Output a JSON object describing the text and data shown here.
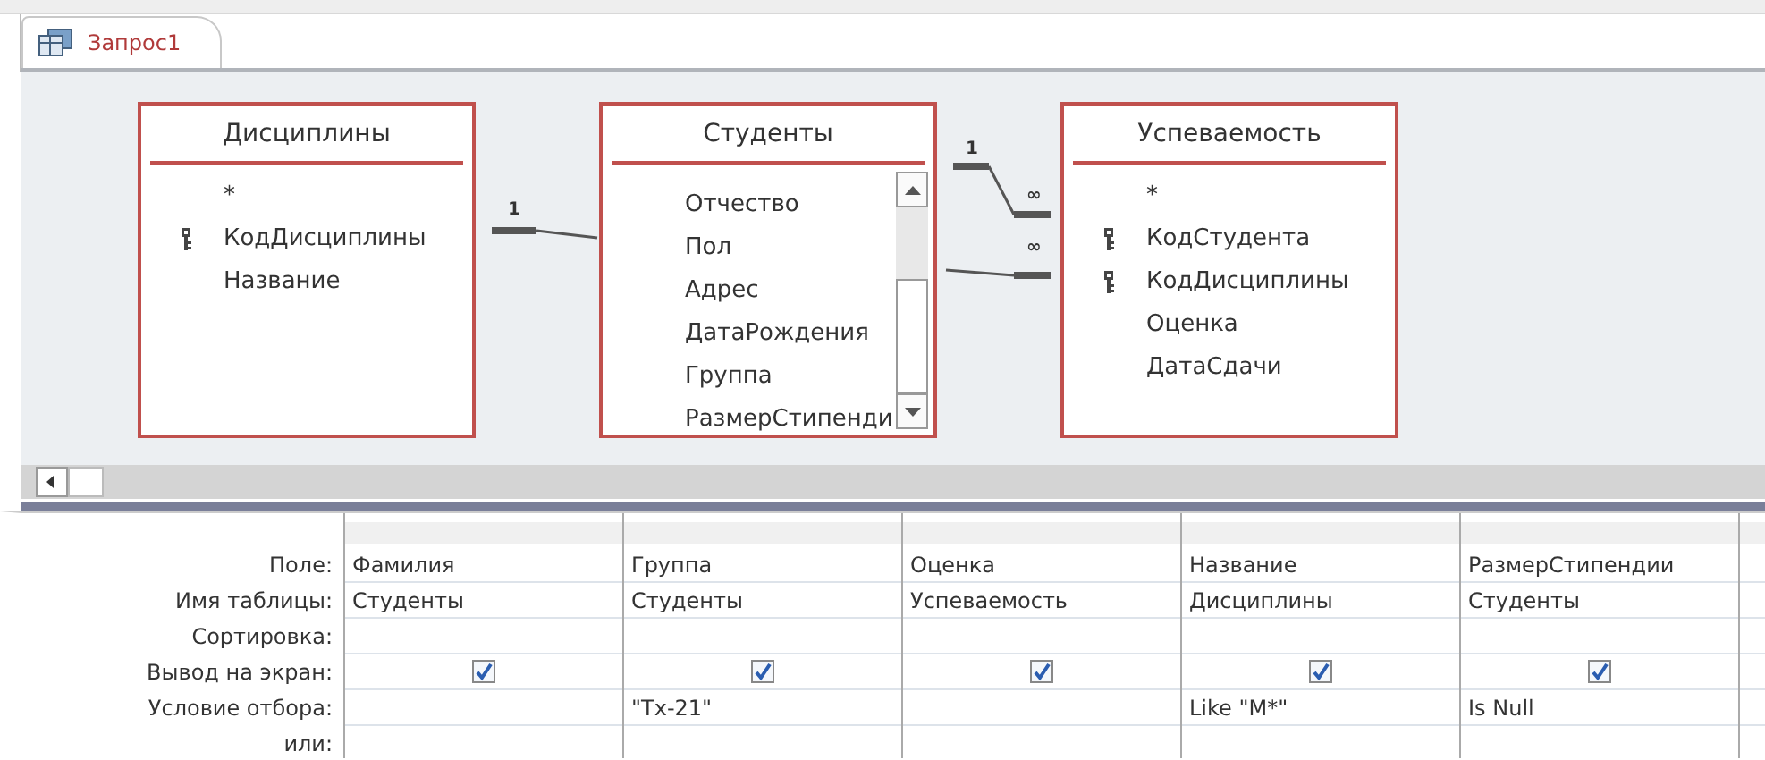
{
  "tab": {
    "label": "Запрос1",
    "selected": true
  },
  "tables": [
    {
      "title": "Дисциплины",
      "fields": [
        {
          "name": "*",
          "key": false
        },
        {
          "name": "КодДисциплины",
          "key": true
        },
        {
          "name": "Название",
          "key": false
        }
      ]
    },
    {
      "title": "Студенты",
      "scrollbar": true,
      "fields": [
        {
          "name": "Отчество",
          "key": false
        },
        {
          "name": "Пол",
          "key": false
        },
        {
          "name": "Адрес",
          "key": false
        },
        {
          "name": "ДатаРождения",
          "key": false
        },
        {
          "name": "Группа",
          "key": false
        },
        {
          "name": "РазмерСтипенди",
          "key": false
        }
      ]
    },
    {
      "title": "Успеваемость",
      "fields": [
        {
          "name": "*",
          "key": false
        },
        {
          "name": "КодСтудента",
          "key": true
        },
        {
          "name": "КодДисциплины",
          "key": true
        },
        {
          "name": "Оценка",
          "key": false
        },
        {
          "name": "ДатаСдачи",
          "key": false
        }
      ]
    }
  ],
  "join_marks": [
    "1",
    "1",
    "∞",
    "∞"
  ],
  "row_labels": [
    "Поле:",
    "Имя таблицы:",
    "Сортировка:",
    "Вывод на экран:",
    "Условие отбора:",
    "или:"
  ],
  "columns": [
    {
      "field": "Фамилия",
      "table": "Студенты",
      "show": true
    },
    {
      "field": "Группа",
      "table": "Студенты",
      "show": true,
      "criteria": "\"Tx-21\""
    },
    {
      "field": "Оценка",
      "table": "Успеваемость",
      "show": true
    },
    {
      "field": "Название",
      "table": "Дисциплины",
      "show": true,
      "criteria": "Like \"M*\""
    },
    {
      "field": "РазмерСтипендии",
      "table": "Студенты",
      "show": true,
      "criteria": "Is Null"
    }
  ]
}
